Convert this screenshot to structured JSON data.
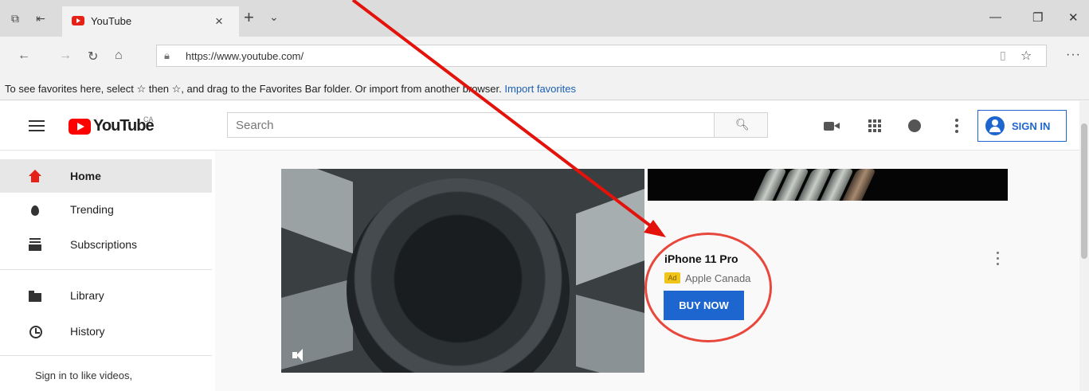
{
  "browser": {
    "tab_title": "YouTube",
    "url": "https://www.youtube.com/",
    "favorites_bar": {
      "message": "To see favorites here, select ☆ then ☆, and drag to the Favorites Bar folder. Or import from another browser.",
      "import_link": "Import favorites"
    }
  },
  "youtube": {
    "logo_text": "YouTube",
    "country_code": "CA",
    "search_placeholder": "Search",
    "sign_in_label": "SIGN IN",
    "accent_color": "#1e66cf",
    "brand_color": "#ff0000"
  },
  "sidebar": {
    "items": [
      {
        "label": "Home",
        "icon": "home-icon"
      },
      {
        "label": "Trending",
        "icon": "trending-icon"
      },
      {
        "label": "Subscriptions",
        "icon": "subscriptions-icon"
      },
      {
        "label": "Library",
        "icon": "library-icon"
      },
      {
        "label": "History",
        "icon": "history-icon"
      }
    ],
    "sign_in_message": "Sign in to like videos,"
  },
  "ad": {
    "title": "iPhone 11 Pro",
    "badge": "Ad",
    "channel": "Apple Canada",
    "cta": "BUY NOW",
    "highlight_color": "#e8473c"
  }
}
